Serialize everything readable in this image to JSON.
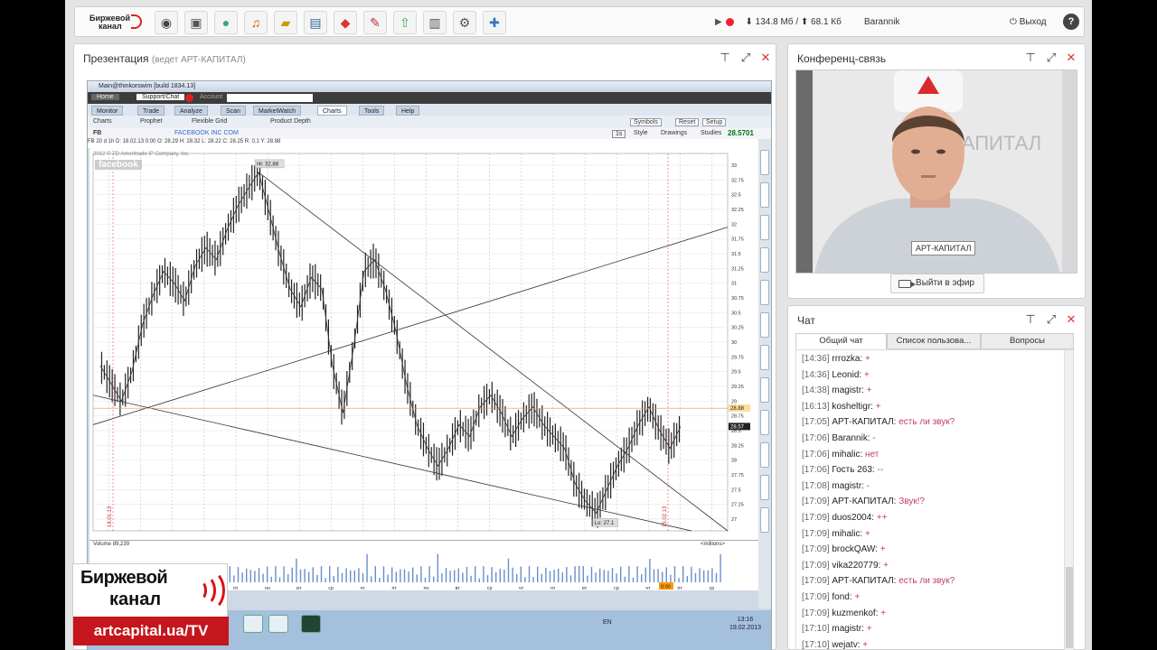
{
  "topbar": {
    "logo_line1": "Биржевой",
    "logo_line2": "канал",
    "tools": [
      "webcam-icon",
      "presentation-icon",
      "chat-bubble-icon",
      "media-icon",
      "folder-icon",
      "document-icon",
      "cube-icon",
      "notes-icon",
      "upload-icon",
      "layout-icon",
      "gear-icon",
      "add-user-icon"
    ],
    "download": "134.8 Мб",
    "upload": "68.1 Кб",
    "username": "Barannik",
    "exit_label": "Выход",
    "help_label": "?"
  },
  "presentation": {
    "title": "Презентация",
    "subtitle": "(ведет АРТ-КАПИТАЛ)",
    "screen": {
      "window_title": "Main@thinkorswim [build 1834.13]",
      "home": "Home",
      "support": "Support/Chat",
      "account": "Account",
      "tabs": [
        "Monitor",
        "Trade",
        "Analyze",
        "Scan",
        "MarketWatch",
        "Charts",
        "Tools",
        "Help"
      ],
      "active_tab": "Charts",
      "subtabs": [
        "Charts",
        "Prophet",
        "Flexible Grid",
        "Product Depth"
      ],
      "symbol": "FB",
      "symbol_desc": "FACEBOOK INC COM",
      "style": "Style",
      "drawings": "Drawings",
      "studies": "Studies",
      "last_price": "28.5701",
      "timeframe": "1s",
      "symbols_btn": "Symbols",
      "reset_btn": "Reset",
      "setup_btn": "Setup",
      "ohlc": "FB 20 d 1h   D: 18.02.13 0:00   O: 28.29   H: 28.32   L: 28.22   C: 28.25   R: 0.1   Y: 28.88",
      "copyright": "2012 © TD Ameritrade IP Company, Inc.",
      "stock_label": "facebook",
      "hi_label": "Hi: 32.88",
      "lo_label": "Lo: 27.1",
      "date_left": "18.01.13",
      "date_right": "15.02.13",
      "volume_label": "Volume",
      "volume_value": "89,239",
      "volume_unit": "<millions>",
      "price_tag_1": "28.88",
      "price_tag_2": "28.57",
      "time_tag": "0:00",
      "taskbar_lang": "EN",
      "taskbar_time": "13:16",
      "taskbar_date": "19.02.2013"
    }
  },
  "chart_data": {
    "type": "line",
    "title": "FB",
    "xlabel": "",
    "ylabel": "",
    "ylim": [
      26.8,
      33.2
    ],
    "y_ticks": [
      "33",
      "32.75",
      "32.5",
      "32.25",
      "32",
      "31.75",
      "31.5",
      "31.25",
      "31",
      "30.75",
      "30.5",
      "30.25",
      "30",
      "29.75",
      "29.5",
      "29.25",
      "29",
      "28.75",
      "28.5",
      "28.25",
      "28",
      "27.75",
      "27.5",
      "27.25",
      "27"
    ],
    "x_ticks": [
      "пн",
      "вт",
      "ср",
      "чт",
      "пт",
      "пн",
      "вт",
      "ср",
      "чт",
      "пт",
      "пн",
      "вт",
      "ср",
      "чт",
      "пт",
      "вт",
      "ср",
      "чт",
      "пт",
      "ср"
    ],
    "grid": true,
    "series": [
      {
        "values": [
          29.6,
          29.3,
          29.0,
          29.5,
          30.3,
          30.8,
          31.2,
          31.0,
          30.7,
          31.3,
          31.6,
          31.4,
          31.9,
          32.3,
          32.6,
          32.88,
          32.2,
          31.5,
          30.9,
          30.6,
          31.1,
          30.9,
          29.6,
          28.8,
          29.9,
          31.2,
          31.4,
          30.9,
          30.2,
          29.3,
          28.6,
          28.2,
          27.9,
          28.2,
          28.6,
          28.4,
          28.9,
          29.1,
          28.8,
          28.4,
          28.7,
          28.9,
          28.6,
          28.4,
          28.2,
          27.6,
          27.3,
          27.1,
          27.5,
          27.9,
          28.2,
          28.6,
          28.9,
          28.5,
          28.2,
          28.57
        ]
      }
    ],
    "volume": {
      "label": "Volume",
      "unit": "<millions>",
      "value": "89,239"
    }
  },
  "brand": {
    "line1": "Биржевой",
    "line2": "канал",
    "url": "artcapital.ua/TV"
  },
  "conference": {
    "title": "Конференц-связь",
    "speaker_name": "АРТ-КАПИТАЛ",
    "backdrop_text": "А-КАПИТАЛ",
    "broadcast_button": "Выйти в эфир"
  },
  "chat": {
    "title": "Чат",
    "tabs": [
      "Общий чат",
      "Список пользова...",
      "Вопросы"
    ],
    "messages": [
      {
        "time": "[14:36]",
        "name": "rrrozka:",
        "text": "+"
      },
      {
        "time": "[14:36]",
        "name": "Leonid:",
        "text": "+"
      },
      {
        "time": "[14:38]",
        "name": "magistr:",
        "text": "+"
      },
      {
        "time": "[16:13]",
        "name": "kosheltigr:",
        "text": "+"
      },
      {
        "time": "[17:05]",
        "name": "АРТ-КАПИТАЛ:",
        "text": "есть ли звук?"
      },
      {
        "time": "[17:06]",
        "name": "Barannik:",
        "text": "-"
      },
      {
        "time": "[17:06]",
        "name": "mihalic:",
        "text": "нет"
      },
      {
        "time": "[17:06]",
        "name": "Гость 263:",
        "text": "--"
      },
      {
        "time": "[17:08]",
        "name": "magistr:",
        "text": "-"
      },
      {
        "time": "[17:09]",
        "name": "АРТ-КАПИТАЛ:",
        "text": "Звук!?"
      },
      {
        "time": "[17:09]",
        "name": "duos2004:",
        "text": "++"
      },
      {
        "time": "[17:09]",
        "name": "mihalic:",
        "text": "+"
      },
      {
        "time": "[17:09]",
        "name": "brockQAW:",
        "text": "+"
      },
      {
        "time": "[17:09]",
        "name": "vika220779:",
        "text": "+"
      },
      {
        "time": "[17:09]",
        "name": "АРТ-КАПИТАЛ:",
        "text": "есть ли звук?"
      },
      {
        "time": "[17:09]",
        "name": "fond:",
        "text": "+"
      },
      {
        "time": "[17:09]",
        "name": "kuzmenkof:",
        "text": "+"
      },
      {
        "time": "[17:10]",
        "name": "magistr:",
        "text": "+"
      },
      {
        "time": "[17:10]",
        "name": "wejatv:",
        "text": "+"
      }
    ]
  }
}
